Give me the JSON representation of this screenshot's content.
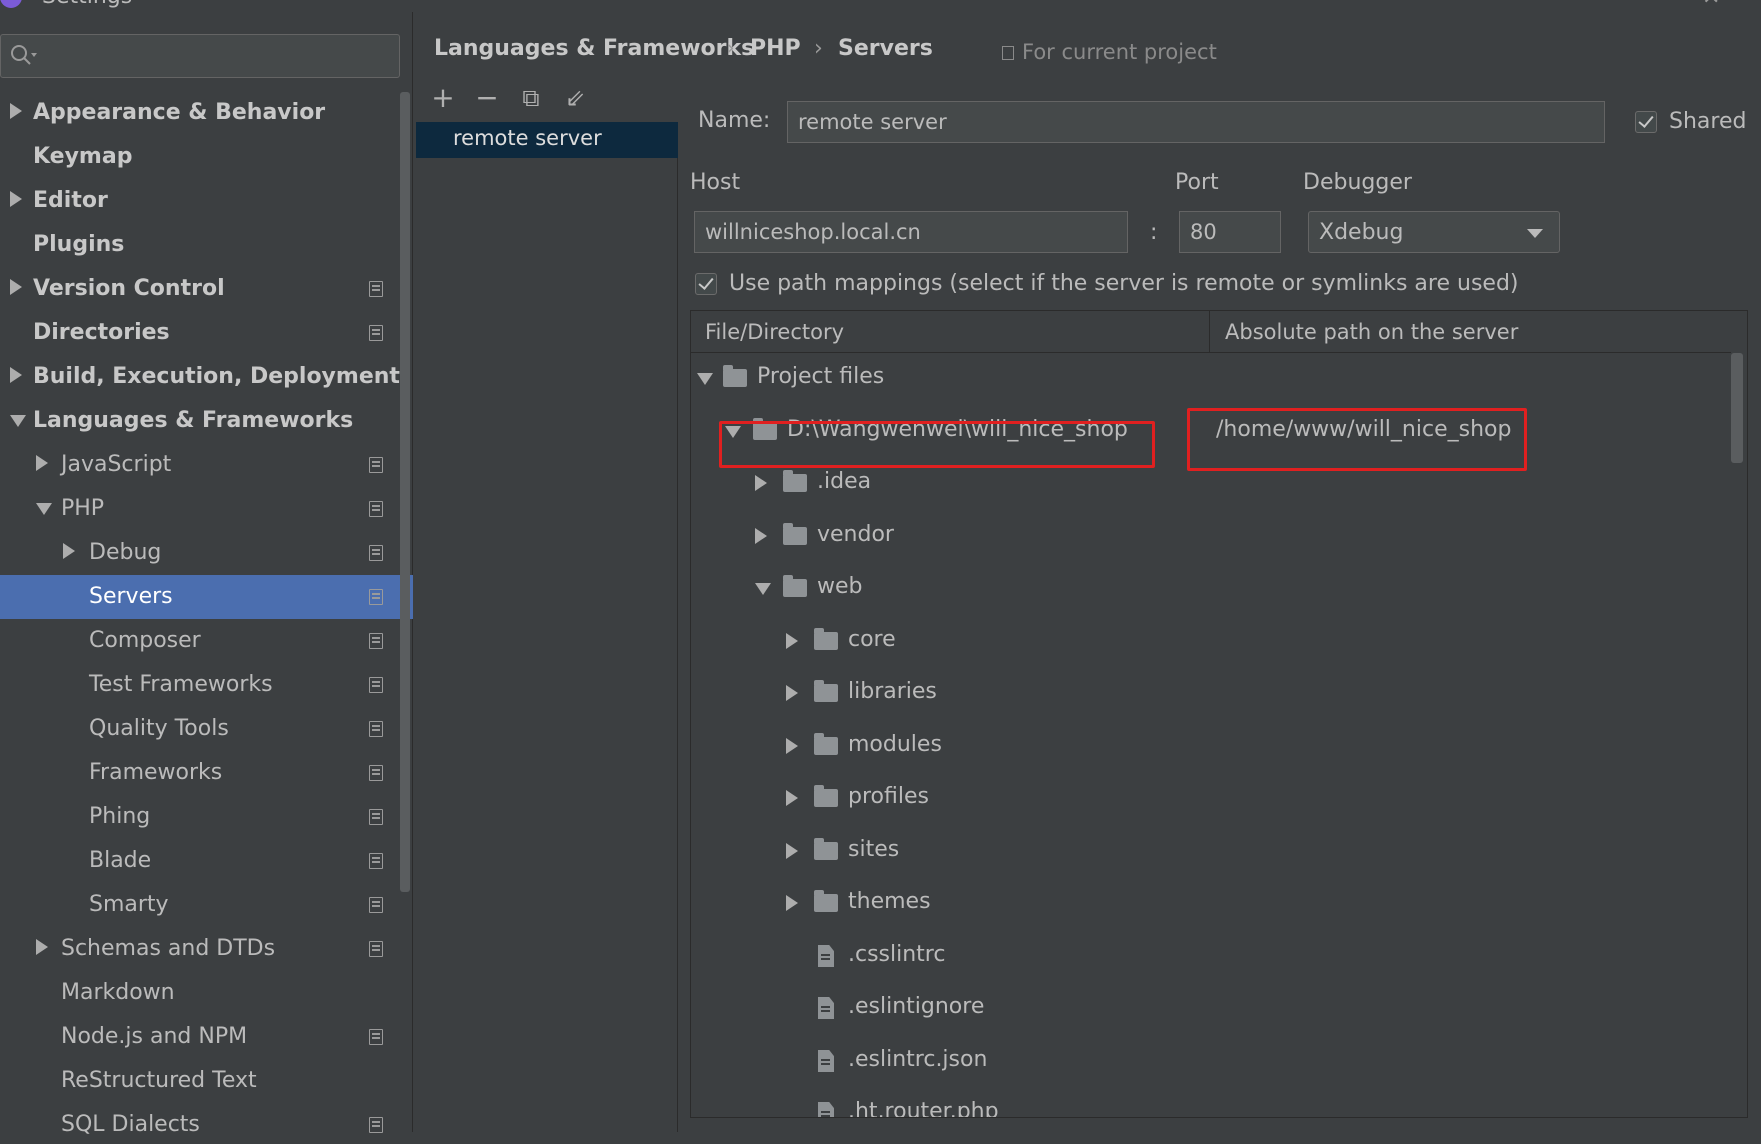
{
  "window": {
    "title": "Settings"
  },
  "sidebar": {
    "search_placeholder": "",
    "items": [
      {
        "label": "Appearance & Behavior",
        "bold": true,
        "level": 0,
        "arrow": "right",
        "proj": false,
        "selected": false
      },
      {
        "label": "Keymap",
        "bold": true,
        "level": 0,
        "arrow": "none",
        "proj": false,
        "selected": false
      },
      {
        "label": "Editor",
        "bold": true,
        "level": 0,
        "arrow": "right",
        "proj": false,
        "selected": false
      },
      {
        "label": "Plugins",
        "bold": true,
        "level": 0,
        "arrow": "none",
        "proj": false,
        "selected": false
      },
      {
        "label": "Version Control",
        "bold": true,
        "level": 0,
        "arrow": "right",
        "proj": true,
        "selected": false
      },
      {
        "label": "Directories",
        "bold": true,
        "level": 0,
        "arrow": "none",
        "proj": true,
        "selected": false
      },
      {
        "label": "Build, Execution, Deployment",
        "bold": true,
        "level": 0,
        "arrow": "right",
        "proj": false,
        "selected": false
      },
      {
        "label": "Languages & Frameworks",
        "bold": true,
        "level": 0,
        "arrow": "down",
        "proj": false,
        "selected": false
      },
      {
        "label": "JavaScript",
        "bold": false,
        "level": 1,
        "arrow": "right",
        "proj": true,
        "selected": false
      },
      {
        "label": "PHP",
        "bold": false,
        "level": 1,
        "arrow": "down",
        "proj": true,
        "selected": false
      },
      {
        "label": "Debug",
        "bold": false,
        "level": 2,
        "arrow": "right",
        "proj": true,
        "selected": false
      },
      {
        "label": "Servers",
        "bold": false,
        "level": 2,
        "arrow": "none",
        "proj": true,
        "selected": true
      },
      {
        "label": "Composer",
        "bold": false,
        "level": 2,
        "arrow": "none",
        "proj": true,
        "selected": false
      },
      {
        "label": "Test Frameworks",
        "bold": false,
        "level": 2,
        "arrow": "none",
        "proj": true,
        "selected": false
      },
      {
        "label": "Quality Tools",
        "bold": false,
        "level": 2,
        "arrow": "none",
        "proj": true,
        "selected": false
      },
      {
        "label": "Frameworks",
        "bold": false,
        "level": 2,
        "arrow": "none",
        "proj": true,
        "selected": false
      },
      {
        "label": "Phing",
        "bold": false,
        "level": 2,
        "arrow": "none",
        "proj": true,
        "selected": false
      },
      {
        "label": "Blade",
        "bold": false,
        "level": 2,
        "arrow": "none",
        "proj": true,
        "selected": false
      },
      {
        "label": "Smarty",
        "bold": false,
        "level": 2,
        "arrow": "none",
        "proj": true,
        "selected": false
      },
      {
        "label": "Schemas and DTDs",
        "bold": false,
        "level": 1,
        "arrow": "right",
        "proj": true,
        "selected": false
      },
      {
        "label": "Markdown",
        "bold": false,
        "level": 1,
        "arrow": "none",
        "proj": false,
        "selected": false
      },
      {
        "label": "Node.js and NPM",
        "bold": false,
        "level": 1,
        "arrow": "none",
        "proj": true,
        "selected": false
      },
      {
        "label": "ReStructured Text",
        "bold": false,
        "level": 1,
        "arrow": "none",
        "proj": false,
        "selected": false
      },
      {
        "label": "SQL Dialects",
        "bold": false,
        "level": 1,
        "arrow": "none",
        "proj": true,
        "selected": false
      }
    ]
  },
  "breadcrumb": {
    "items": [
      "Languages & Frameworks",
      "PHP",
      "Servers"
    ],
    "separator": "›",
    "scope": "For current project"
  },
  "server_list": {
    "toolbar": {
      "add": "+",
      "remove": "−",
      "copy": "⧉",
      "import": "⇙"
    },
    "items": [
      "remote server"
    ]
  },
  "form": {
    "name_label": "Name:",
    "name_value": "remote server",
    "shared_label": "Shared",
    "shared_checked": true,
    "host_label": "Host",
    "host_value": "willniceshop.local.cn",
    "port_separator": ":",
    "port_label": "Port",
    "port_value": "80",
    "debugger_label": "Debugger",
    "debugger_value": "Xdebug",
    "use_path_mappings_label": "Use path mappings (select if the server is remote or symlinks are used)",
    "use_path_mappings_checked": true
  },
  "mappings": {
    "col_file": "File/Directory",
    "col_server": "Absolute path on the server",
    "rows": [
      {
        "label": "Project files",
        "depth": 0,
        "arrow": "down",
        "kind": "folder",
        "server_path": ""
      },
      {
        "label": "D:\\Wangwenwei\\will_nice_shop",
        "depth": 1,
        "arrow": "down",
        "kind": "folder",
        "server_path": "/home/www/will_nice_shop"
      },
      {
        "label": ".idea",
        "depth": 2,
        "arrow": "right",
        "kind": "folder",
        "server_path": ""
      },
      {
        "label": "vendor",
        "depth": 2,
        "arrow": "right",
        "kind": "folder",
        "server_path": ""
      },
      {
        "label": "web",
        "depth": 2,
        "arrow": "down",
        "kind": "folder",
        "server_path": ""
      },
      {
        "label": "core",
        "depth": 3,
        "arrow": "right",
        "kind": "folder",
        "server_path": ""
      },
      {
        "label": "libraries",
        "depth": 3,
        "arrow": "right",
        "kind": "folder",
        "server_path": ""
      },
      {
        "label": "modules",
        "depth": 3,
        "arrow": "right",
        "kind": "folder",
        "server_path": ""
      },
      {
        "label": "profiles",
        "depth": 3,
        "arrow": "right",
        "kind": "folder",
        "server_path": ""
      },
      {
        "label": "sites",
        "depth": 3,
        "arrow": "right",
        "kind": "folder",
        "server_path": ""
      },
      {
        "label": "themes",
        "depth": 3,
        "arrow": "right",
        "kind": "folder",
        "server_path": ""
      },
      {
        "label": ".csslintrc",
        "depth": 3,
        "arrow": "none",
        "kind": "file",
        "server_path": ""
      },
      {
        "label": ".eslintignore",
        "depth": 3,
        "arrow": "none",
        "kind": "file",
        "server_path": ""
      },
      {
        "label": ".eslintrc.json",
        "depth": 3,
        "arrow": "none",
        "kind": "file",
        "server_path": ""
      },
      {
        "label": ".ht.router.php",
        "depth": 3,
        "arrow": "none",
        "kind": "file",
        "server_path": ""
      }
    ]
  },
  "colors": {
    "selection": "#4b6eaf",
    "highlight": "#e02020",
    "background": "#3c3f41"
  }
}
